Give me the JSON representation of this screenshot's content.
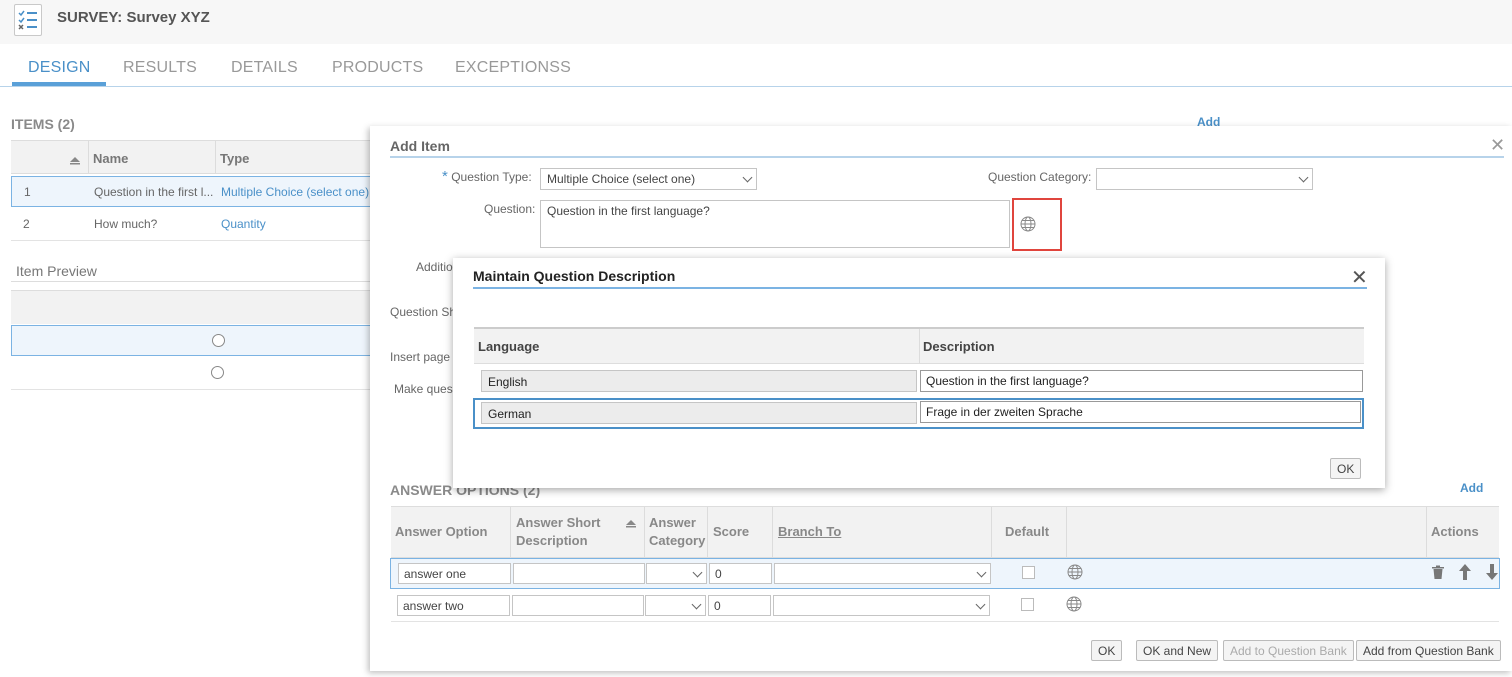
{
  "header": {
    "title": "SURVEY: Survey XYZ"
  },
  "tabs": [
    {
      "label": "DESIGN",
      "active": true
    },
    {
      "label": "RESULTS"
    },
    {
      "label": "DETAILS"
    },
    {
      "label": "PRODUCTS"
    },
    {
      "label": "EXCEPTIONSS"
    }
  ],
  "items_section": {
    "title": "ITEMS (2)",
    "columns": [
      "Name",
      "Type"
    ],
    "rows": [
      {
        "num": "1",
        "name": "Question in the first l...",
        "type": "Multiple Choice (select one)"
      },
      {
        "num": "2",
        "name": "How much?",
        "type": "Quantity"
      }
    ],
    "add_label": "Add"
  },
  "item_preview": {
    "title": "Item Preview"
  },
  "add_item": {
    "title": "Add Item",
    "question_type_label": "Question Type:",
    "question_type_value": "Multiple Choice (select one)",
    "question_category_label": "Question Category:",
    "question_category_value": "",
    "question_label": "Question:",
    "question_value": "Question in the first language?",
    "partial_labels": [
      "Additio",
      "Question Sh",
      "Insert page",
      "Make ques"
    ]
  },
  "dialog": {
    "title": "Maintain Question Description",
    "columns": [
      "Language",
      "Description"
    ],
    "rows": [
      {
        "language": "English",
        "description": "Question in the first language?"
      },
      {
        "language": "German",
        "description": "Frage in der zweiten Sprache"
      }
    ],
    "ok_label": "OK"
  },
  "answer_options": {
    "title": "ANSWER OPTIONS (2)",
    "add_label": "Add",
    "columns": {
      "answer_option": "Answer Option",
      "short_desc_1": "Answer Short",
      "short_desc_2": "Description",
      "category_1": "Answer",
      "category_2": "Category",
      "score": "Score",
      "branch_to": "Branch To",
      "default": "Default",
      "actions": "Actions"
    },
    "rows": [
      {
        "answer": "answer one",
        "short_desc": "",
        "category": "",
        "score": "0",
        "branch_to": "",
        "default": false
      },
      {
        "answer": "answer two",
        "short_desc": "",
        "category": "",
        "score": "0",
        "branch_to": "",
        "default": false
      }
    ]
  },
  "footer_buttons": {
    "ok": "OK",
    "ok_new": "OK and New",
    "add_to_bank": "Add to Question Bank",
    "add_from_bank": "Add from Question Bank"
  },
  "icons": {
    "survey": "checklist-icon",
    "close": "close-icon",
    "globe": "globe-icon",
    "delete": "trash-icon",
    "up": "arrow-up-icon",
    "down": "arrow-down-icon",
    "sort": "sort-icon"
  },
  "colors": {
    "accent": "#4a90c8",
    "highlight": "#e0453d"
  }
}
